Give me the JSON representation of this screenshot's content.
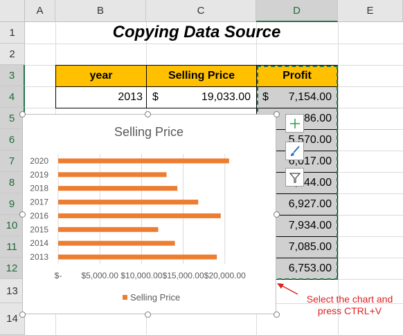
{
  "columns": [
    "A",
    "B",
    "C",
    "D",
    "E"
  ],
  "rows": [
    "1",
    "2",
    "3",
    "4",
    "5",
    "6",
    "7",
    "8",
    "9",
    "10",
    "11",
    "12",
    "13",
    "14"
  ],
  "title": "Copying Data Source",
  "table": {
    "headers": {
      "year": "year",
      "price": "Selling Price",
      "profit": "Profit"
    },
    "first_row": {
      "year": "2013",
      "currency": "$",
      "price": "19,033.00",
      "profit_currency": "$",
      "profit": "7,154.00"
    },
    "profits_visible": [
      "86.00",
      "5,570.00",
      "6,017.00",
      "5,744.00",
      "6,927.00",
      "7,934.00",
      "7,085.00",
      "6,753.00"
    ]
  },
  "chart_data": {
    "type": "bar",
    "orientation": "horizontal",
    "title": "Selling Price",
    "categories": [
      "2013",
      "2014",
      "2015",
      "2016",
      "2017",
      "2018",
      "2019",
      "2020"
    ],
    "series": [
      {
        "name": "Selling Price",
        "color": "#ed7d31",
        "values": [
          19033,
          14000,
          12000,
          19500,
          16800,
          14300,
          13000,
          20500
        ]
      }
    ],
    "x_ticks": [
      "$-",
      "$5,000.00",
      "$10,000.00",
      "$15,000.00",
      "$20,000.00"
    ],
    "xlim": [
      0,
      25000
    ],
    "legend_position": "bottom",
    "grid": true
  },
  "chart_buttons": [
    "plus-icon",
    "brush-icon",
    "filter-icon"
  ],
  "annotation": {
    "line1": "Select the chart and",
    "line2": "press CTRL+V",
    "color": "#e02020"
  }
}
